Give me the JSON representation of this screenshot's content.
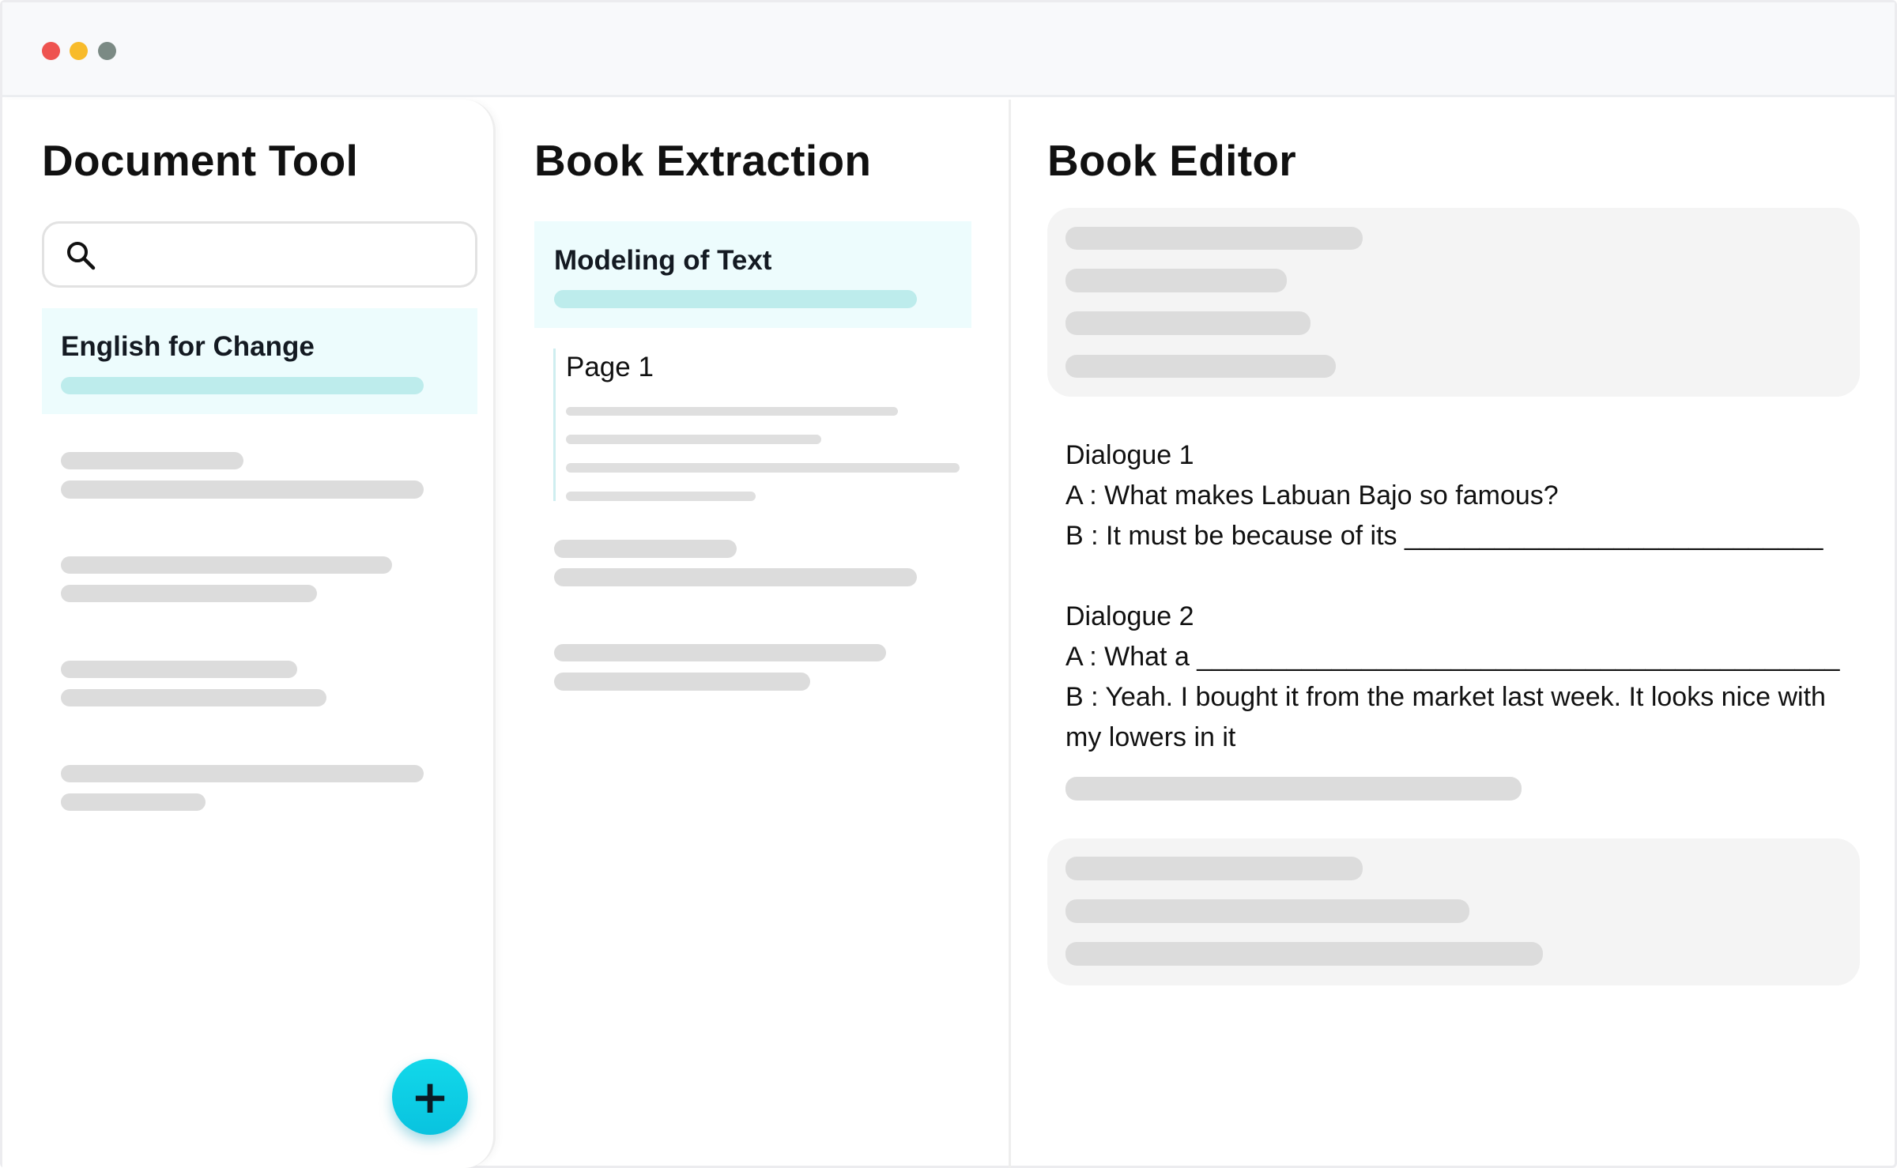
{
  "window": {
    "controls": [
      "close",
      "minimize",
      "zoom"
    ]
  },
  "document_tool": {
    "title": "Document Tool",
    "search": {
      "value": "",
      "placeholder": ""
    },
    "active_document": "English for Change",
    "add_button": "+"
  },
  "book_extraction": {
    "title": "Book Extraction",
    "active_section": "Modeling of Text",
    "page_label": "Page 1"
  },
  "book_editor": {
    "title": "Book Editor",
    "dialogues": [
      {
        "heading": "Dialogue 1",
        "lines": [
          "A : What makes Labuan Bajo so famous?",
          "B : It must be because of its ____________________________"
        ]
      },
      {
        "heading": "Dialogue 2",
        "lines": [
          "A : What a ___________________________________________",
          "B : Yeah. I bought it from the market last week. It looks nice with my lowers in it"
        ]
      }
    ]
  },
  "colors": {
    "accent_teal": "#bdecec",
    "active_card_bg": "#edfcfd",
    "fab": "#12d8ea",
    "close_dot": "#ee5350",
    "minimize_dot": "#f8bb2b",
    "zoom_dot": "#7b8a84"
  }
}
